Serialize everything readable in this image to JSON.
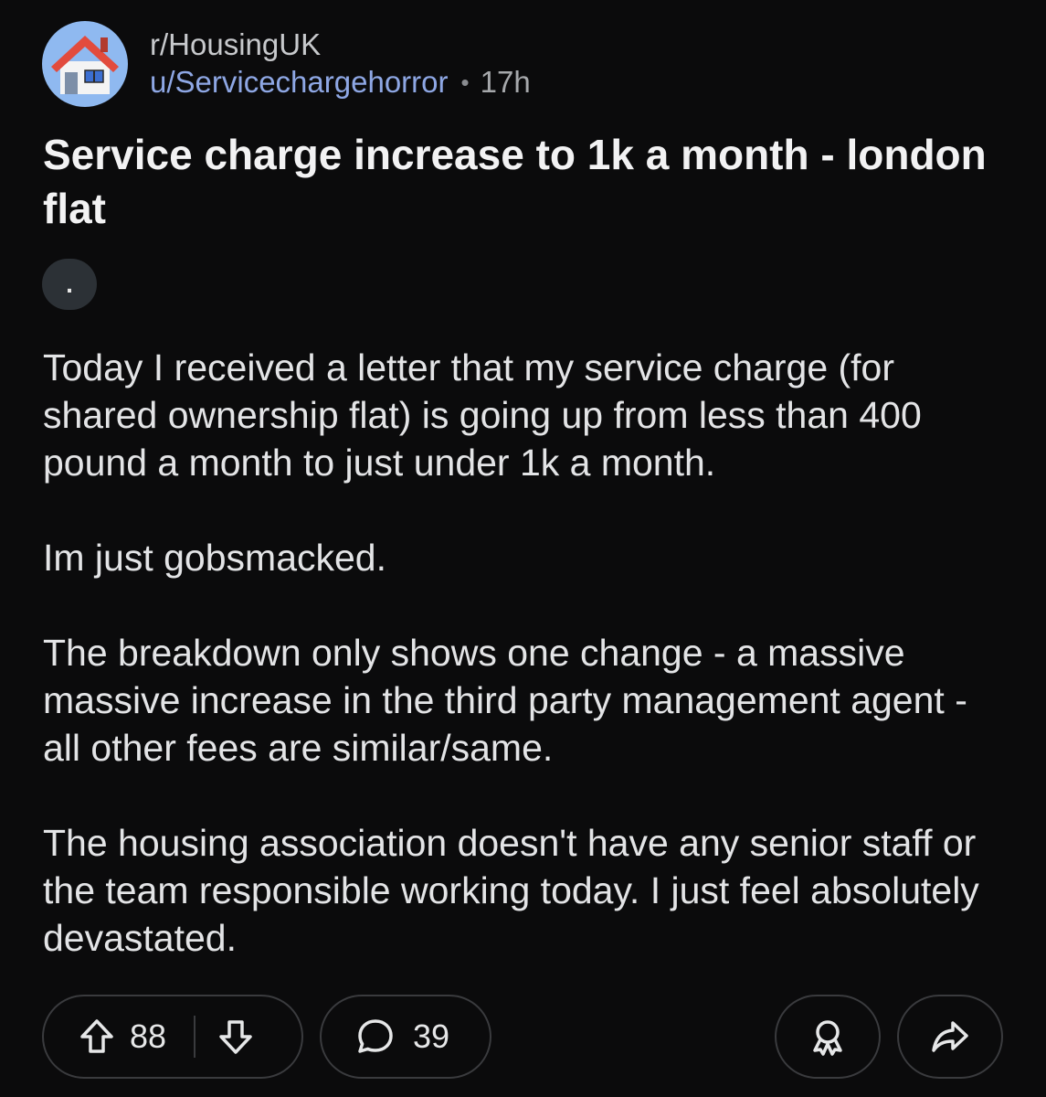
{
  "header": {
    "subreddit": "r/HousingUK",
    "author": "u/Servicechargehorror",
    "separator": "•",
    "time": "17h",
    "avatar_icon": "house-icon"
  },
  "post": {
    "title": "Service charge increase to 1k a month - london flat",
    "flair": ".",
    "paragraphs": [
      "Today I received a letter that my service charge (for shared ownership flat) is going up from less than 400 pound a month to just under 1k a month.",
      "Im just gobsmacked.",
      "The breakdown only shows one change - a massive massive increase in the third party management agent - all other fees are similar/same.",
      "The housing association doesn't have any senior staff or the team responsible working today. I just feel absolutely devastated."
    ]
  },
  "actions": {
    "upvotes": "88",
    "comments": "39",
    "icons": [
      "upvote-icon",
      "downvote-icon",
      "comment-icon",
      "award-icon",
      "share-icon"
    ]
  },
  "colors": {
    "background": "#0b0b0c",
    "author": "#8ea7e4",
    "pill_border": "#3a3b3e"
  }
}
